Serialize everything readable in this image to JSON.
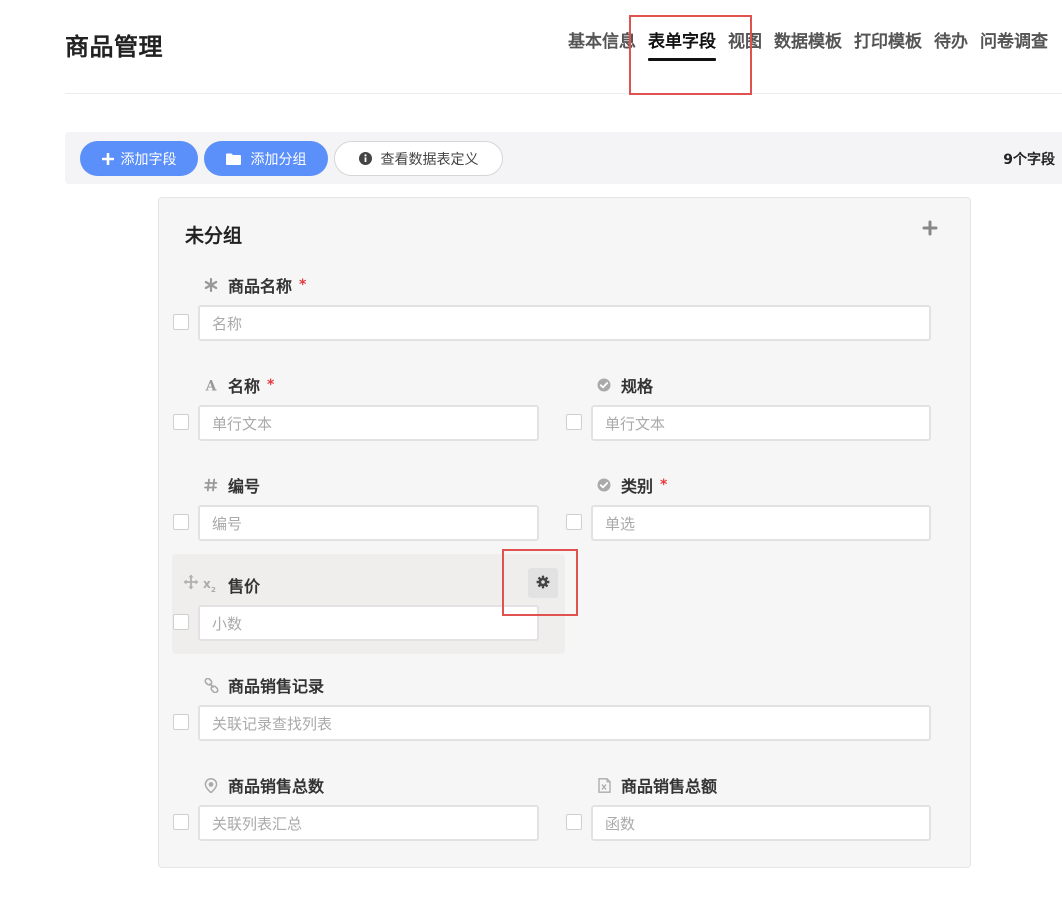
{
  "header": {
    "title": "商品管理",
    "tabs": [
      {
        "label": "基本信息",
        "active": false
      },
      {
        "label": "表单字段",
        "active": true
      },
      {
        "label": "视图",
        "active": false
      },
      {
        "label": "数据模板",
        "active": false
      },
      {
        "label": "打印模板",
        "active": false
      },
      {
        "label": "待办",
        "active": false
      },
      {
        "label": "问卷调查",
        "active": false
      }
    ]
  },
  "toolbar": {
    "add_field": "添加字段",
    "add_group": "添加分组",
    "view_definition": "查看数据表定义",
    "field_count": "9个字段"
  },
  "group": {
    "title": "未分组",
    "fields": [
      {
        "label": "商品名称",
        "required": true,
        "icon": "asterisk-icon",
        "placeholder": "名称"
      },
      {
        "label": "名称",
        "required": true,
        "icon": "text-a-icon",
        "placeholder": "单行文本"
      },
      {
        "label": "规格",
        "required": false,
        "icon": "check-circle-icon",
        "placeholder": "单行文本"
      },
      {
        "label": "编号",
        "required": false,
        "icon": "hash-icon",
        "placeholder": "编号"
      },
      {
        "label": "类别",
        "required": true,
        "icon": "check-circle-icon",
        "placeholder": "单选"
      },
      {
        "label": "售价",
        "required": false,
        "icon": "subscript-x-icon",
        "placeholder": "小数"
      },
      {
        "label": "商品销售记录",
        "required": false,
        "icon": "link-icon",
        "placeholder": "关联记录查找列表"
      },
      {
        "label": "商品销售总数",
        "required": false,
        "icon": "location-pin-icon",
        "placeholder": "关联列表汇总"
      },
      {
        "label": "商品销售总额",
        "required": false,
        "icon": "function-icon",
        "placeholder": "函数"
      }
    ]
  },
  "required_mark": "*",
  "colors": {
    "primary": "#5b8ff9",
    "required": "#e4393c",
    "highlight": "#e0524f"
  }
}
